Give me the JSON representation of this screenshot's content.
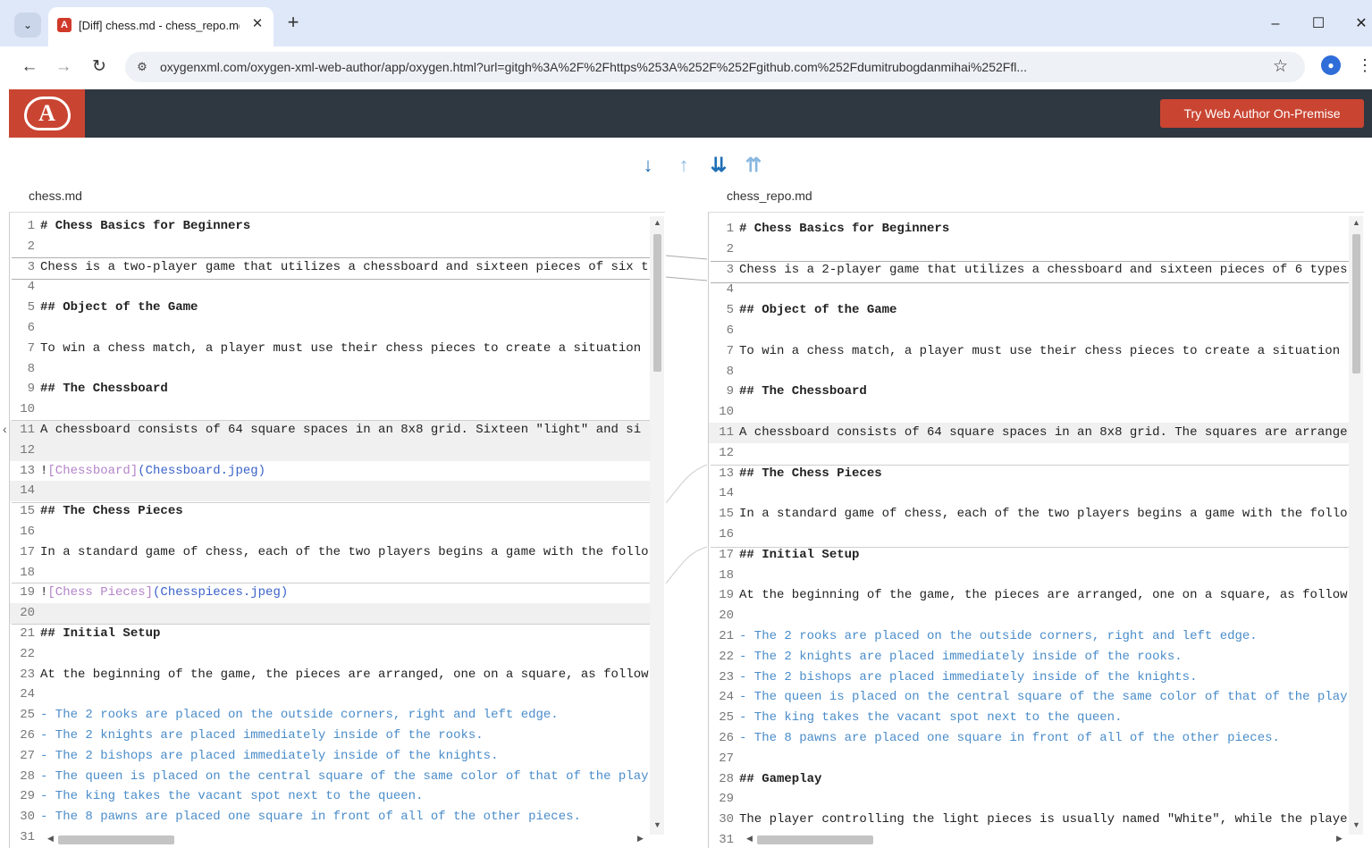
{
  "browser": {
    "tab_title": "[Diff] chess.md - chess_repo.md",
    "tab_favicon": "oxygen-favicon",
    "url": "oxygenxml.com/oxygen-xml-web-author/app/oxygen.html?url=gitgh%3A%2F%2Fhttps%253A%252F%252Fgithub.com%252Fdumitrubogdanmihai%252Ffl...",
    "win_min": "–",
    "win_max": "☐",
    "win_close": "✕"
  },
  "app": {
    "logo_letter": "A",
    "try_button": "Try Web Author On-Premise"
  },
  "diff_nav": {
    "next_change": "↓",
    "prev_change": "↑",
    "last_change": "⇊",
    "first_change": "⇈"
  },
  "left": {
    "file_name": "chess.md",
    "lines": [
      {
        "n": "1",
        "t": "# Chess Basics for Beginners",
        "k": "heading"
      },
      {
        "n": "2",
        "t": "",
        "k": "plain"
      },
      {
        "n": "3",
        "t": "Chess is a two-player game that utilizes a chessboard and sixteen pieces of six t",
        "k": "plain"
      },
      {
        "n": "4",
        "t": "",
        "k": "plain"
      },
      {
        "n": "5",
        "t": "## Object of the Game",
        "k": "heading"
      },
      {
        "n": "6",
        "t": "",
        "k": "plain"
      },
      {
        "n": "7",
        "t": "To win a chess match, a player must use their chess pieces to create a situation",
        "k": "plain"
      },
      {
        "n": "8",
        "t": "",
        "k": "plain"
      },
      {
        "n": "9",
        "t": "## The Chessboard",
        "k": "heading"
      },
      {
        "n": "10",
        "t": "",
        "k": "plain"
      },
      {
        "n": "11",
        "t": "A chessboard consists of 64 square spaces in an 8x8 grid. Sixteen \"light\" and si",
        "k": "shade"
      },
      {
        "n": "12",
        "t": "",
        "k": "shade"
      },
      {
        "n": "13",
        "t": "![Chessboard](Chessboard.jpeg)",
        "k": "img"
      },
      {
        "n": "14",
        "t": "",
        "k": "shade"
      },
      {
        "n": "15",
        "t": "## The Chess Pieces",
        "k": "heading"
      },
      {
        "n": "16",
        "t": "",
        "k": "plain"
      },
      {
        "n": "17",
        "t": "In a standard game of chess, each of the two players begins a game with the follo",
        "k": "plain"
      },
      {
        "n": "18",
        "t": "",
        "k": "plain"
      },
      {
        "n": "19",
        "t": "![Chess Pieces](Chesspieces.jpeg)",
        "k": "img"
      },
      {
        "n": "20",
        "t": "",
        "k": "shade"
      },
      {
        "n": "21",
        "t": "## Initial Setup",
        "k": "heading"
      },
      {
        "n": "22",
        "t": "",
        "k": "plain"
      },
      {
        "n": "23",
        "t": "At the beginning of the game, the pieces are arranged, one on a square, as follow",
        "k": "plain"
      },
      {
        "n": "24",
        "t": "",
        "k": "plain"
      },
      {
        "n": "25",
        "t": "- The 2 rooks are placed on the outside corners, right and left edge.",
        "k": "list"
      },
      {
        "n": "26",
        "t": "- The 2 knights are placed immediately inside of the rooks.",
        "k": "list"
      },
      {
        "n": "27",
        "t": "- The 2 bishops are placed immediately inside of the knights.",
        "k": "list"
      },
      {
        "n": "28",
        "t": "- The queen is placed on the central square of the same color of that of the play",
        "k": "list"
      },
      {
        "n": "29",
        "t": "- The king takes the vacant spot next to the queen.",
        "k": "list"
      },
      {
        "n": "30",
        "t": "- The 8 pawns are placed one square in front of all of the other pieces.",
        "k": "list"
      },
      {
        "n": "31",
        "t": "",
        "k": "plain"
      }
    ]
  },
  "right": {
    "file_name": "chess_repo.md",
    "lines": [
      {
        "n": "1",
        "t": "# Chess Basics for Beginners",
        "k": "heading"
      },
      {
        "n": "2",
        "t": "",
        "k": "plain"
      },
      {
        "n": "3",
        "t": "Chess is a 2-player game that utilizes a chessboard and sixteen pieces of 6 types",
        "k": "plain"
      },
      {
        "n": "4",
        "t": "",
        "k": "plain"
      },
      {
        "n": "5",
        "t": "## Object of the Game",
        "k": "heading"
      },
      {
        "n": "6",
        "t": "",
        "k": "plain"
      },
      {
        "n": "7",
        "t": "To win a chess match, a player must use their chess pieces to create a situation",
        "k": "plain"
      },
      {
        "n": "8",
        "t": "",
        "k": "plain"
      },
      {
        "n": "9",
        "t": "## The Chessboard",
        "k": "heading"
      },
      {
        "n": "10",
        "t": "",
        "k": "plain"
      },
      {
        "n": "11",
        "t": "A chessboard consists of 64 square spaces in an 8x8 grid. The squares are arrange",
        "k": "shade"
      },
      {
        "n": "12",
        "t": "",
        "k": "plain"
      },
      {
        "n": "13",
        "t": "## The Chess Pieces",
        "k": "heading"
      },
      {
        "n": "14",
        "t": "",
        "k": "plain"
      },
      {
        "n": "15",
        "t": "In a standard game of chess, each of the two players begins a game with the follo",
        "k": "plain"
      },
      {
        "n": "16",
        "t": "",
        "k": "plain"
      },
      {
        "n": "17",
        "t": "## Initial Setup",
        "k": "heading"
      },
      {
        "n": "18",
        "t": "",
        "k": "plain"
      },
      {
        "n": "19",
        "t": "At the beginning of the game, the pieces are arranged, one on a square, as follow",
        "k": "plain"
      },
      {
        "n": "20",
        "t": "",
        "k": "plain"
      },
      {
        "n": "21",
        "t": "- The 2 rooks are placed on the outside corners, right and left edge.",
        "k": "list"
      },
      {
        "n": "22",
        "t": "- The 2 knights are placed immediately inside of the rooks.",
        "k": "list"
      },
      {
        "n": "23",
        "t": "- The 2 bishops are placed immediately inside of the knights.",
        "k": "list"
      },
      {
        "n": "24",
        "t": "- The queen is placed on the central square of the same color of that of the play",
        "k": "list"
      },
      {
        "n": "25",
        "t": "- The king takes the vacant spot next to the queen.",
        "k": "list"
      },
      {
        "n": "26",
        "t": "- The 8 pawns are placed one square in front of all of the other pieces.",
        "k": "list"
      },
      {
        "n": "27",
        "t": "",
        "k": "plain"
      },
      {
        "n": "28",
        "t": "## Gameplay",
        "k": "heading"
      },
      {
        "n": "29",
        "t": "",
        "k": "plain"
      },
      {
        "n": "30",
        "t": "The player controlling the light pieces is usually named \"White\", while the playe",
        "k": "plain"
      },
      {
        "n": "31",
        "t": "",
        "k": "plain"
      }
    ]
  },
  "colors": {
    "brand_red": "#c94532",
    "app_bar": "#2f3741",
    "nav_blue": "#1f6fb5",
    "nav_light_blue": "#8ab8e0",
    "list_text": "#4a8cc9"
  }
}
